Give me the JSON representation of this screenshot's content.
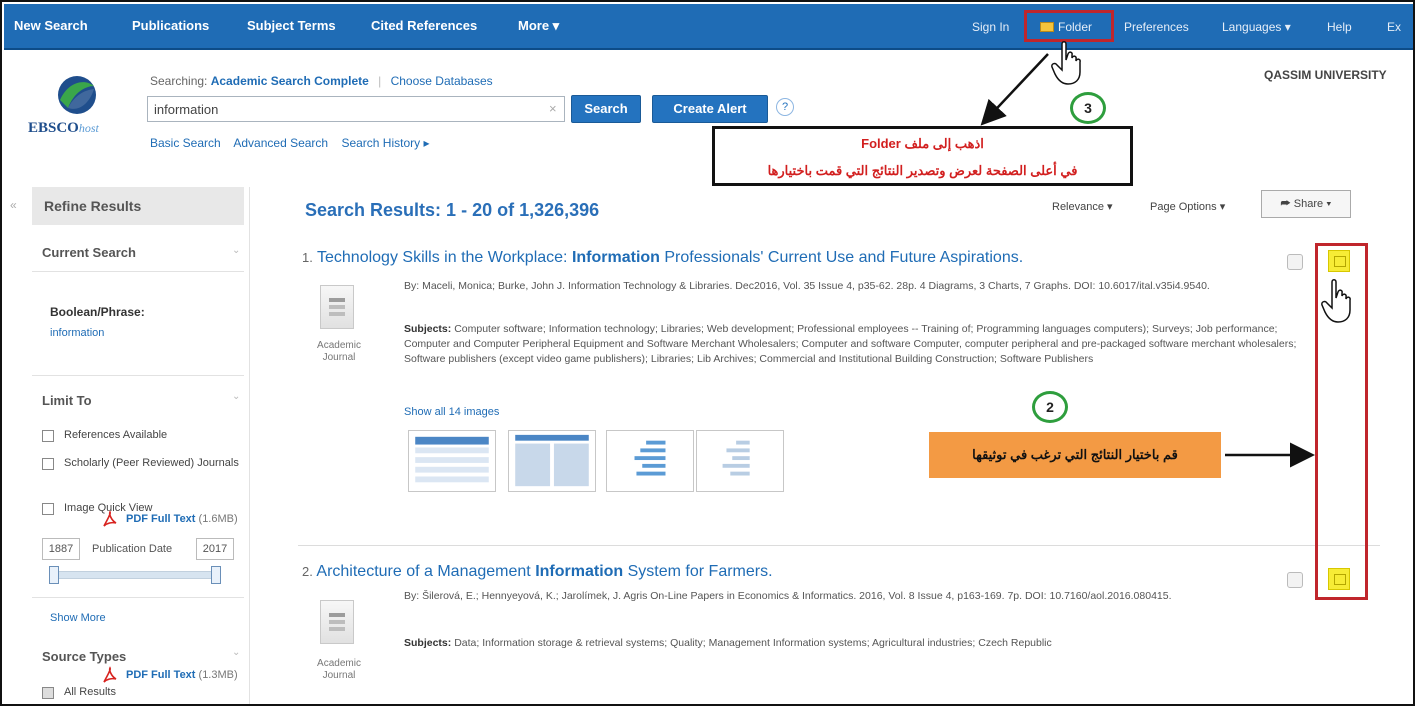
{
  "topnav": {
    "items": [
      "New Search",
      "Publications",
      "Subject Terms",
      "Cited References",
      "More ▾"
    ],
    "right": [
      "Sign In",
      "Folder",
      "Preferences",
      "Languages ▾",
      "Help",
      "Ex"
    ]
  },
  "header": {
    "logo_main": "EBSCO",
    "logo_sub": "host",
    "searching_label": "Searching:",
    "database": "Academic Search Complete",
    "choose": "Choose Databases",
    "search_value": "information",
    "clear": "×",
    "search_button": "Search",
    "create_alert_button": "Create Alert",
    "help": "?",
    "links": [
      "Basic Search",
      "Advanced Search",
      "Search History ▸"
    ],
    "institution": "QASSIM UNIVERSITY"
  },
  "sidebar": {
    "collapse": "«",
    "refine_title": "Refine Results",
    "current_search": "Current Search",
    "boolean_label": "Boolean/Phrase:",
    "boolean_value": "information",
    "limit_to": "Limit To",
    "checkboxes": [
      "References Available",
      "Scholarly (Peer Reviewed) Journals",
      "Image Quick View"
    ],
    "date_from": "1887",
    "date_label": "Publication Date",
    "date_to": "2017",
    "show_more": "Show More",
    "source_types": "Source Types",
    "all_results": "All Results"
  },
  "results": {
    "heading": "Search Results: 1 - 20 of 1,326,396",
    "sort": "Relevance ▾",
    "page_options": "Page Options ▾",
    "share": "Share ▾",
    "doc_type": "Academic Journal",
    "items": [
      {
        "num": "1.",
        "title_a": "Technology Skills in the Workplace: ",
        "title_bold": "Information",
        "title_b": " Professionals' Current Use and Future Aspirations.",
        "by": "By: Maceli, Monica; Burke, John J. Information Technology & Libraries. Dec2016, Vol. 35 Issue 4, p35-62. 28p. 4 Diagrams, 3 Charts, 7 Graphs. DOI: 10.6017/ital.v35i4.9540.",
        "subjects_label": "Subjects:",
        "subjects": "Computer software; Information technology; Libraries; Web development; Professional employees -- Training of; Programming languages computers); Surveys; Job performance; Computer and Computer Peripheral Equipment and Software Merchant Wholesalers; Computer and software Computer, computer peripheral and pre-packaged software merchant wholesalers; Software publishers (except video game publishers); Libraries; Lib Archives; Commercial and Institutional Building Construction; Software Publishers",
        "images_link": "Show all 14 images",
        "pdf": "PDF Full Text",
        "pdf_size": "(1.6MB)"
      },
      {
        "num": "2.",
        "title_a": "Architecture of a Management ",
        "title_bold": "Information",
        "title_b": " System for Farmers.",
        "by": "By: Šilerová, E.; Hennyeyová, K.; Jarolímek, J. Agris On-Line Papers in Economics & Informatics. 2016, Vol. 8 Issue 4, p163-169. 7p. DOI: 10.7160/aol.2016.080415.",
        "subjects_label": "Subjects:",
        "subjects": "Data; Information storage & retrieval systems; Quality; Management Information systems; Agricultural industries; Czech Republic",
        "pdf": "PDF Full Text",
        "pdf_size": "(1.3MB)"
      }
    ]
  },
  "annotations": {
    "step3": "3",
    "step2": "2",
    "box_line1": "اذهب إلى ملف Folder",
    "box_line2": "في أعلى الصفحة لعرض وتصدير النتائج التي قمت باختيارها",
    "orange": "قم باختيار النتائج التي ترغب في توثيقها"
  },
  "colors": {
    "nav_bg": "#1f6cb5",
    "highlight_red": "#c0262c",
    "circle_green": "#2e9e3d",
    "orange": "#f39a44",
    "folder_yellow": "#f7ec36"
  }
}
